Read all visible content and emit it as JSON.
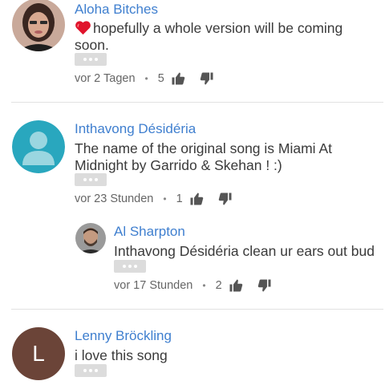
{
  "comments": [
    {
      "author": "Aloha Bitches",
      "text": "hopefully a whole version will be coming soon.",
      "time": "vor 2 Tagen",
      "likes": "5",
      "has_heart": true
    },
    {
      "author": "Inthavong Désidéria",
      "text": "The name of the original song is Miami At Midnight by Garrido & Skehan ! :)",
      "time": "vor 23 Stunden",
      "likes": "1"
    },
    {
      "author": "Al Sharpton",
      "text": "Inthavong Désidéria clean ur ears out bud",
      "time": "vor 17 Stunden",
      "likes": "2"
    },
    {
      "author": "Lenny Bröckling",
      "text": "i love this song",
      "avatar_letter": "L"
    }
  ],
  "colors": {
    "author": "#3f7fcf",
    "lenny_avatar": "#6b4438",
    "default_avatar": "#29a7be"
  },
  "icons": [
    "heart-icon",
    "thumbs-up-icon",
    "thumbs-down-icon",
    "more-icon",
    "default-avatar-icon"
  ]
}
